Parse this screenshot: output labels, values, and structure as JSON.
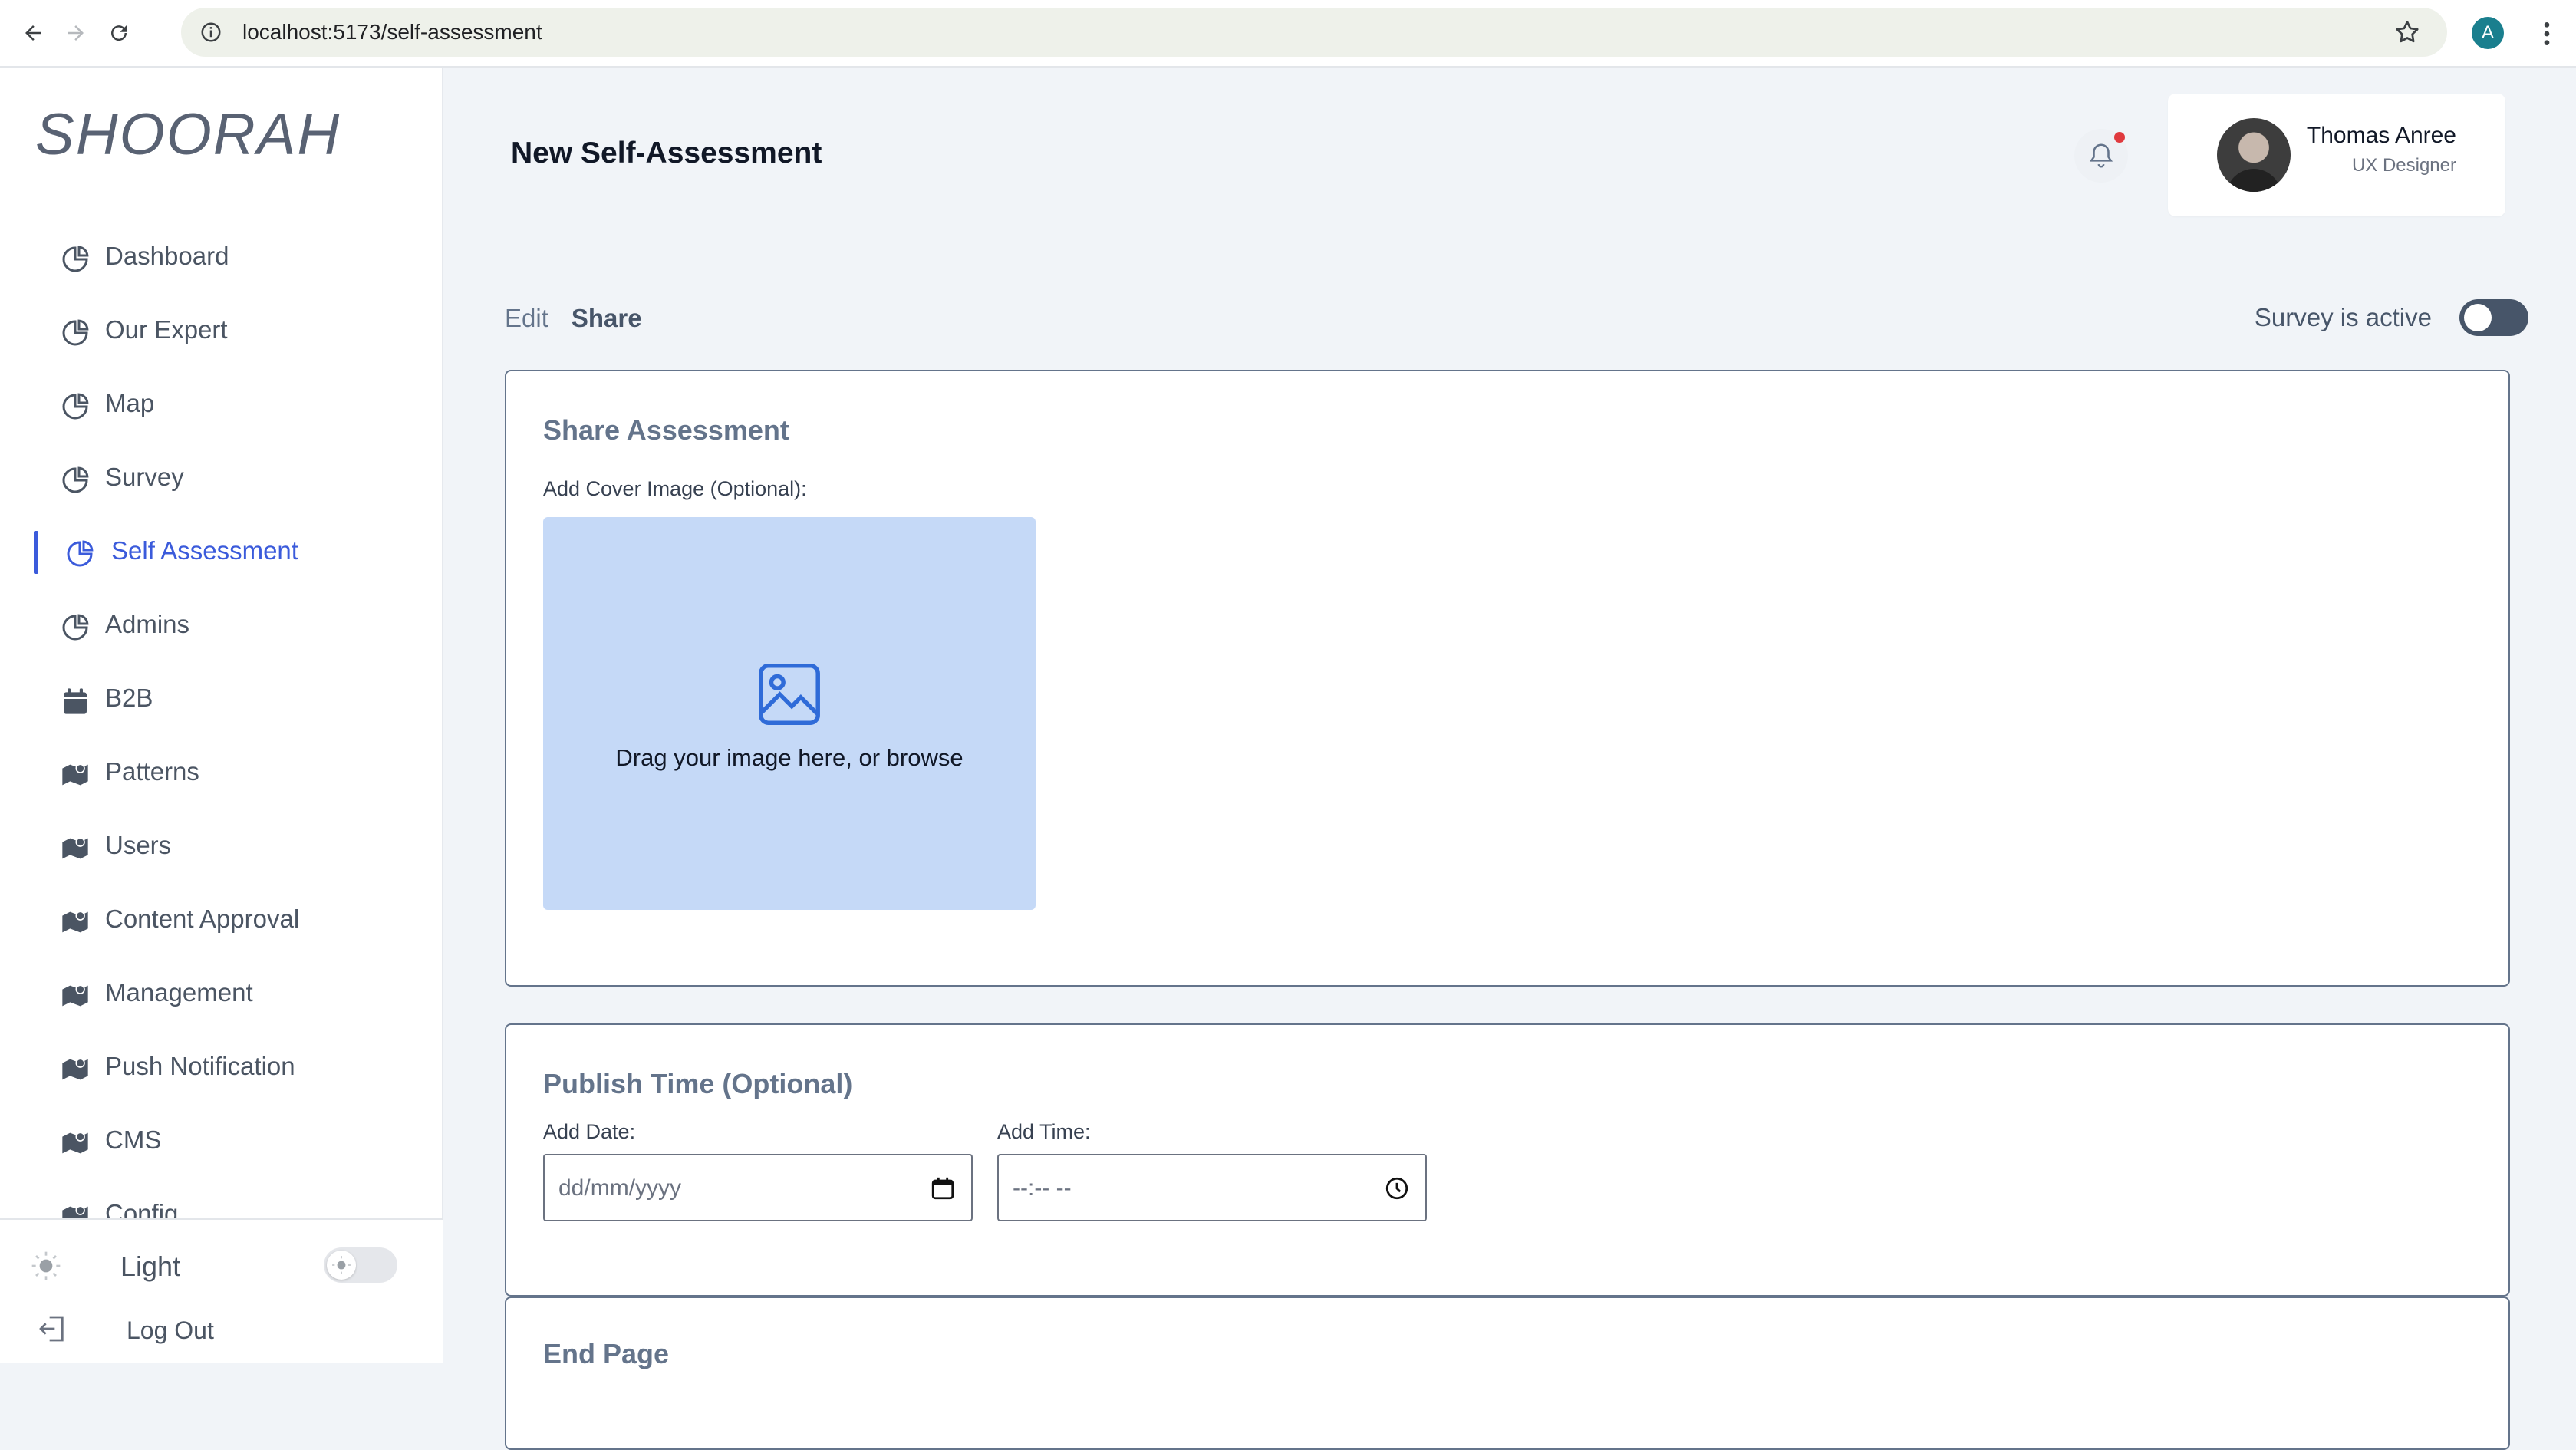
{
  "browser": {
    "url": "localhost:5173/self-assessment",
    "profile_initial": "A"
  },
  "sidebar": {
    "logo": "SHOORAH",
    "items": [
      {
        "label": "Dashboard",
        "icon": "pie-chart-icon"
      },
      {
        "label": "Our Expert",
        "icon": "pie-chart-icon"
      },
      {
        "label": "Map",
        "icon": "pie-chart-icon"
      },
      {
        "label": "Survey",
        "icon": "pie-chart-icon"
      },
      {
        "label": "Self Assessment",
        "icon": "pie-chart-icon",
        "active": true
      },
      {
        "label": "Admins",
        "icon": "pie-chart-icon"
      },
      {
        "label": "B2B",
        "icon": "calendar-icon"
      },
      {
        "label": "Patterns",
        "icon": "map-icon"
      },
      {
        "label": "Users",
        "icon": "map-icon"
      },
      {
        "label": "Content Approval",
        "icon": "map-icon"
      },
      {
        "label": "Management",
        "icon": "map-icon"
      },
      {
        "label": "Push Notification",
        "icon": "map-icon"
      },
      {
        "label": "CMS",
        "icon": "map-icon"
      },
      {
        "label": "Config",
        "icon": "map-icon"
      }
    ],
    "theme_label": "Light",
    "logout_label": "Log Out",
    "accent": "#3b5bdb"
  },
  "header": {
    "title": "New Self-Assessment",
    "has_notification": true,
    "user": {
      "name": "Thomas Anree",
      "role": "UX Designer"
    }
  },
  "tabs": [
    {
      "label": "Edit",
      "active": false
    },
    {
      "label": "Share",
      "active": true
    }
  ],
  "survey_active": {
    "label": "Survey is active",
    "on": false
  },
  "share_card": {
    "title": "Share Assessment",
    "cover_label": "Add Cover Image (Optional):",
    "drop_text": "Drag your image here, or browse"
  },
  "publish_card": {
    "title": "Publish Time (Optional)",
    "date_label": "Add Date:",
    "date_placeholder": "dd/mm/yyyy",
    "time_label": "Add Time:",
    "time_placeholder": "--:-- --"
  },
  "end_card": {
    "title": "End Page"
  }
}
